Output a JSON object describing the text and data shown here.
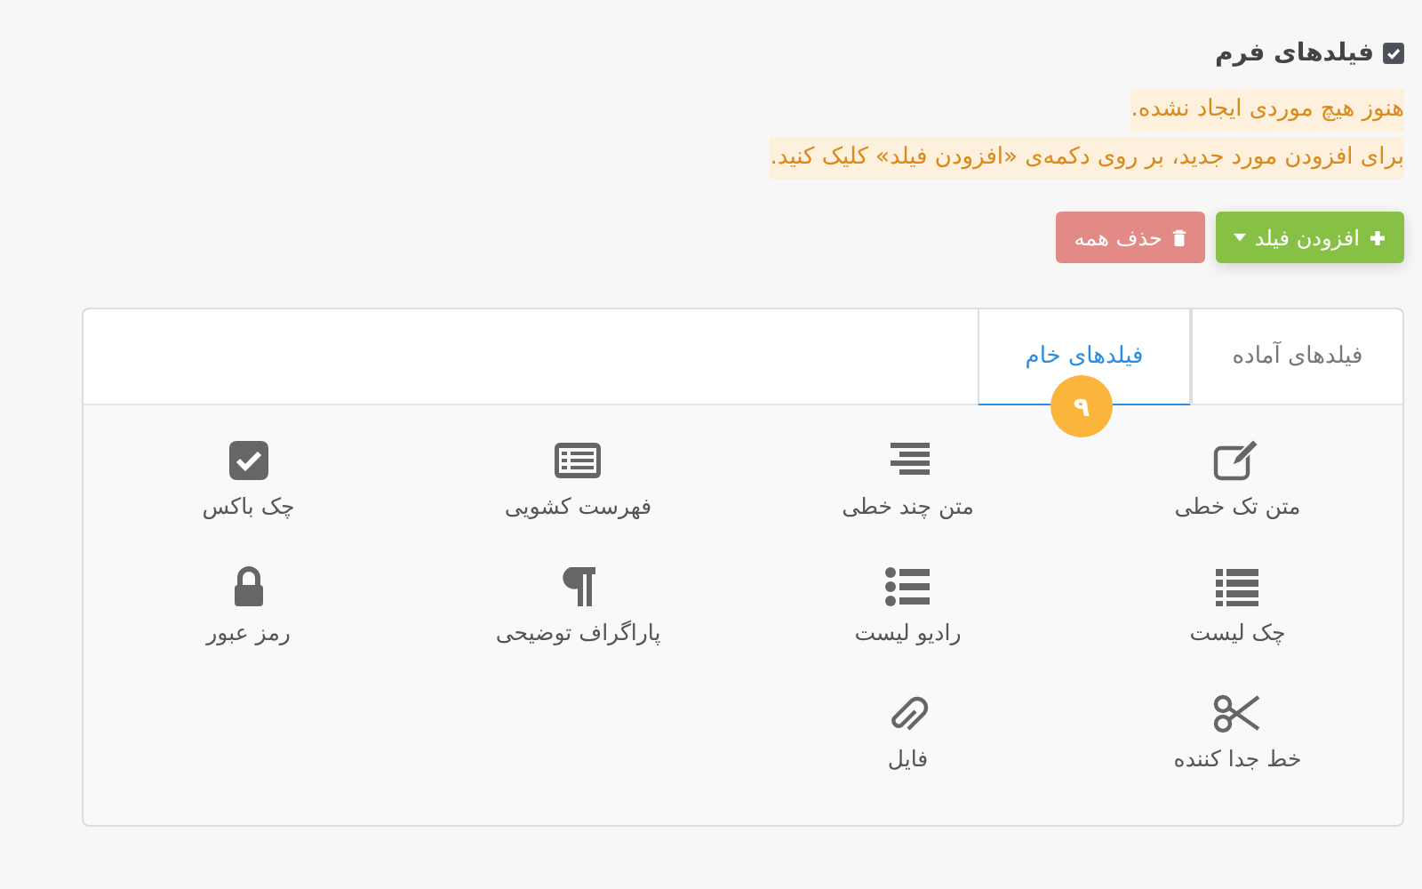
{
  "section": {
    "title": "فیلدهای فرم",
    "checked": true
  },
  "notice": [
    "هنوز هیچ موردی ایجاد نشده.",
    "برای افزودن مورد جدید، بر روی دکمه‌ی «افزودن فیلد» کلیک کنید."
  ],
  "buttons": [
    {
      "kind": "add",
      "label": "افزودن فیلد"
    },
    {
      "kind": "delete",
      "label": "حذف همه"
    }
  ],
  "tabs": [
    {
      "label": "فیلدهای آماده",
      "selected": false
    },
    {
      "label": "فیلدهای خام",
      "selected": true,
      "badge": "۹"
    }
  ],
  "fields": [
    {
      "kind": "edit",
      "label": "متن تک خطی"
    },
    {
      "kind": "align",
      "label": "متن چند خطی"
    },
    {
      "kind": "listalt",
      "label": "فهرست کشویی"
    },
    {
      "kind": "checkbox",
      "label": "چک باکس"
    },
    {
      "kind": "list",
      "label": "چک لیست"
    },
    {
      "kind": "listul",
      "label": "رادیو لیست"
    },
    {
      "kind": "paragraph",
      "label": "پاراگراف توضیحی"
    },
    {
      "kind": "lock",
      "label": "رمز عبور"
    },
    {
      "kind": "scissors",
      "label": "خط جدا کننده"
    },
    {
      "kind": "clip",
      "label": "فایل"
    }
  ]
}
